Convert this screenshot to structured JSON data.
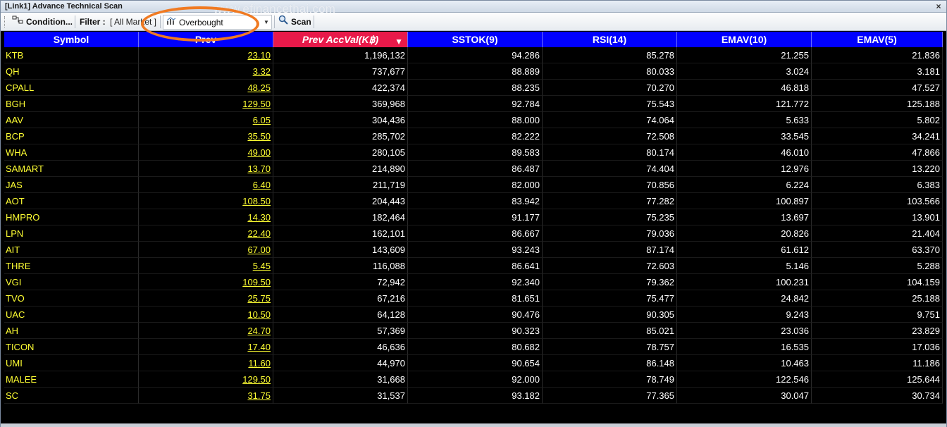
{
  "window": {
    "title": "[Link1] Advance Technical Scan",
    "close_glyph": "×"
  },
  "watermark": "www.efinancethai.com",
  "toolbar": {
    "condition_label": "Condition...",
    "filter_label": "Filter :",
    "filter_value": "[ All Market ]",
    "scan_preset": "Overbought",
    "scan_label": "Scan"
  },
  "icons": {
    "condition": "condition-icon",
    "preset": "scan-preset-icon",
    "scan": "magnifier-icon",
    "dropdown": "chevron-down-icon",
    "sort": "sort-descending-icon"
  },
  "colors": {
    "header_bg": "#0000ff",
    "sorted_header_bg": "#e8194a",
    "symbol_text": "#ffff33",
    "value_text": "#ffffff",
    "grid_bg": "#000000",
    "highlight_ring": "#f07a22"
  },
  "table": {
    "columns": [
      "Symbol",
      "Prev",
      "Prev AccVal(K฿)",
      "SSTOK(9)",
      "RSI(14)",
      "EMAV(10)",
      "EMAV(5)"
    ],
    "sort_arrow": "▼",
    "rows": [
      [
        "KTB",
        "23.10",
        "1,196,132",
        "94.286",
        "85.278",
        "21.255",
        "21.836"
      ],
      [
        "QH",
        "3.32",
        "737,677",
        "88.889",
        "80.033",
        "3.024",
        "3.181"
      ],
      [
        "CPALL",
        "48.25",
        "422,374",
        "88.235",
        "70.270",
        "46.818",
        "47.527"
      ],
      [
        "BGH",
        "129.50",
        "369,968",
        "92.784",
        "75.543",
        "121.772",
        "125.188"
      ],
      [
        "AAV",
        "6.05",
        "304,436",
        "88.000",
        "74.064",
        "5.633",
        "5.802"
      ],
      [
        "BCP",
        "35.50",
        "285,702",
        "82.222",
        "72.508",
        "33.545",
        "34.241"
      ],
      [
        "WHA",
        "49.00",
        "280,105",
        "89.583",
        "80.174",
        "46.010",
        "47.866"
      ],
      [
        "SAMART",
        "13.70",
        "214,890",
        "86.487",
        "74.404",
        "12.976",
        "13.220"
      ],
      [
        "JAS",
        "6.40",
        "211,719",
        "82.000",
        "70.856",
        "6.224",
        "6.383"
      ],
      [
        "AOT",
        "108.50",
        "204,443",
        "83.942",
        "77.282",
        "100.897",
        "103.566"
      ],
      [
        "HMPRO",
        "14.30",
        "182,464",
        "91.177",
        "75.235",
        "13.697",
        "13.901"
      ],
      [
        "LPN",
        "22.40",
        "162,101",
        "86.667",
        "79.036",
        "20.826",
        "21.404"
      ],
      [
        "AIT",
        "67.00",
        "143,609",
        "93.243",
        "87.174",
        "61.612",
        "63.370"
      ],
      [
        "THRE",
        "5.45",
        "116,088",
        "86.641",
        "72.603",
        "5.146",
        "5.288"
      ],
      [
        "VGI",
        "109.50",
        "72,942",
        "92.340",
        "79.362",
        "100.231",
        "104.159"
      ],
      [
        "TVO",
        "25.75",
        "67,216",
        "81.651",
        "75.477",
        "24.842",
        "25.188"
      ],
      [
        "UAC",
        "10.50",
        "64,128",
        "90.476",
        "90.305",
        "9.243",
        "9.751"
      ],
      [
        "AH",
        "24.70",
        "57,369",
        "90.323",
        "85.021",
        "23.036",
        "23.829"
      ],
      [
        "TICON",
        "17.40",
        "46,636",
        "80.682",
        "78.757",
        "16.535",
        "17.036"
      ],
      [
        "UMI",
        "11.60",
        "44,970",
        "90.654",
        "86.148",
        "10.463",
        "11.186"
      ],
      [
        "MALEE",
        "129.50",
        "31,668",
        "92.000",
        "78.749",
        "122.546",
        "125.644"
      ],
      [
        "SC",
        "31.75",
        "31,537",
        "93.182",
        "77.365",
        "30.047",
        "30.734"
      ]
    ]
  }
}
